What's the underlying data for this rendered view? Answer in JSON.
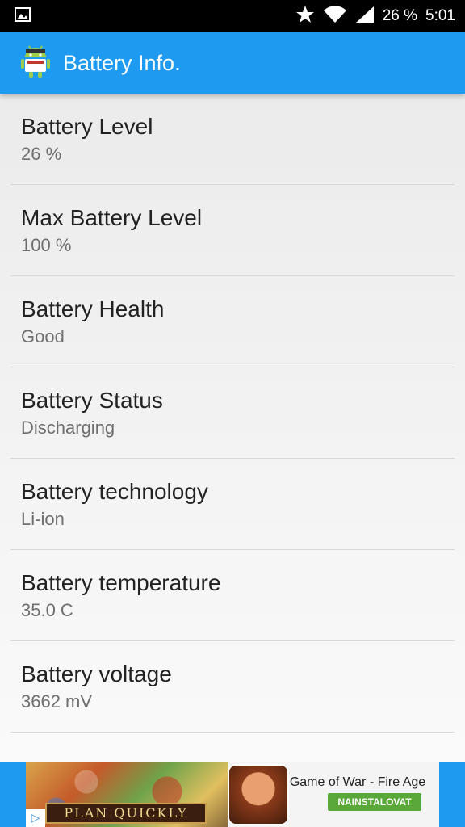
{
  "status_bar": {
    "battery_text": "26 %",
    "time": "5:01",
    "icons": [
      "image-notification-icon",
      "star-icon",
      "wifi-icon",
      "signal-icon"
    ]
  },
  "app_bar": {
    "title": "Battery Info.",
    "icon": "android-robot-icon",
    "color": "#1e9bf0"
  },
  "items": [
    {
      "label": "Battery Level",
      "value": "26 %"
    },
    {
      "label": "Max Battery Level",
      "value": "100 %"
    },
    {
      "label": "Battery Health",
      "value": "Good"
    },
    {
      "label": "Battery Status",
      "value": "Discharging"
    },
    {
      "label": "Battery technology",
      "value": "Li-ion"
    },
    {
      "label": "Battery temperature",
      "value": "35.0 C"
    },
    {
      "label": "Battery voltage",
      "value": "3662 mV"
    }
  ],
  "ad": {
    "banner_text": "PLAN QUICKLY",
    "title": "Game of War - Fire Age",
    "cta": "NAINSTALOVAT",
    "cta_color": "#5aa83a"
  }
}
